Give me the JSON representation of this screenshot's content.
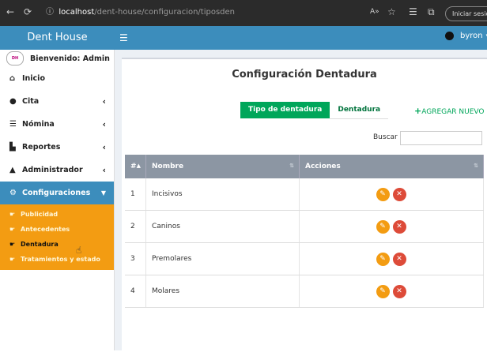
{
  "browser": {
    "url_host": "localhost",
    "url_path": "/dent-house/configuracion/tiposden",
    "signin_label": "Iniciar sesión"
  },
  "app": {
    "brand": "Dent House",
    "user": "byron"
  },
  "sidebar": {
    "welcome": "Bienvenido: Admin",
    "items": [
      {
        "label": "Inicio",
        "icon": "home-icon"
      },
      {
        "label": "Cita",
        "icon": "clock-icon"
      },
      {
        "label": "Nómina",
        "icon": "list-icon"
      },
      {
        "label": "Reportes",
        "icon": "report-icon"
      },
      {
        "label": "Administrador",
        "icon": "lock-icon"
      },
      {
        "label": "Configuraciones",
        "icon": "gears-icon"
      }
    ],
    "submenu": [
      "Publicidad",
      "Antecedentes",
      "Dentadura",
      "Tratamientos y estado"
    ]
  },
  "page": {
    "title": "Configuración Dentadura",
    "tabs": [
      "Tipo de dentadura",
      "Dentadura"
    ],
    "add_new": "AGREGAR NUEVO",
    "search_label": "Buscar",
    "search_value": ""
  },
  "table": {
    "headers": [
      "#",
      "Nombre",
      "Acciones"
    ],
    "rows": [
      {
        "num": "1",
        "name": "Incisivos"
      },
      {
        "num": "2",
        "name": "Caninos"
      },
      {
        "num": "3",
        "name": "Premolares"
      },
      {
        "num": "4",
        "name": "Molares"
      }
    ]
  },
  "colors": {
    "primary": "#3c8dbc",
    "accent": "#f39c12",
    "success": "#00a65a",
    "danger": "#dd4b39"
  }
}
